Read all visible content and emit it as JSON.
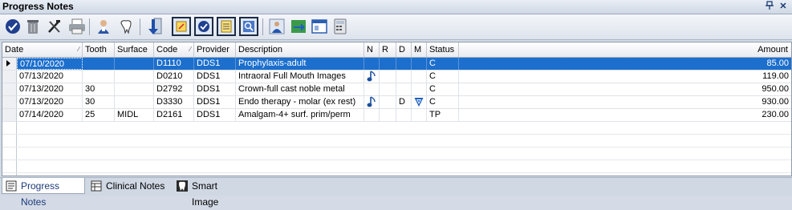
{
  "panel": {
    "title": "Progress Notes",
    "pin_glyph": "ᵖ",
    "close_glyph": "✕"
  },
  "toolbar": {
    "buttons": [
      {
        "icon": "approve-check-icon"
      },
      {
        "icon": "trash-can-icon"
      },
      {
        "icon": "tools-icon"
      },
      {
        "icon": "printer-icon"
      },
      {
        "icon": "patient-icon"
      },
      {
        "icon": "tooth-icon"
      },
      {
        "icon": "download-arrow-icon"
      },
      {
        "icon": "note-pad-icon"
      },
      {
        "icon": "check-note-icon"
      },
      {
        "icon": "list-note-icon"
      },
      {
        "icon": "search-note-icon"
      },
      {
        "icon": "provider-icon"
      },
      {
        "icon": "transfer-icon"
      },
      {
        "icon": "window-icon"
      },
      {
        "icon": "calculator-icon"
      }
    ]
  },
  "grid": {
    "columns": [
      {
        "key": "date",
        "label": "Date",
        "sorted": true
      },
      {
        "key": "tooth",
        "label": "Tooth"
      },
      {
        "key": "surface",
        "label": "Surface"
      },
      {
        "key": "code",
        "label": "Code",
        "sorted": true
      },
      {
        "key": "provider",
        "label": "Provider"
      },
      {
        "key": "description",
        "label": "Description"
      },
      {
        "key": "n",
        "label": "N"
      },
      {
        "key": "r",
        "label": "R"
      },
      {
        "key": "d",
        "label": "D"
      },
      {
        "key": "m",
        "label": "M"
      },
      {
        "key": "status",
        "label": "Status"
      },
      {
        "key": "amount",
        "label": "Amount"
      }
    ],
    "rows": [
      {
        "date": "07/10/2020",
        "tooth": "",
        "surface": "",
        "code": "D1110",
        "provider": "DDS1",
        "description": "Prophylaxis-adult",
        "n": "",
        "r": "",
        "d": "",
        "m": "",
        "status": "C",
        "amount": "85.00",
        "selected": true
      },
      {
        "date": "07/13/2020",
        "tooth": "",
        "surface": "",
        "code": "D0210",
        "provider": "DDS1",
        "description": "Intraoral Full Mouth Images",
        "n": "note",
        "r": "",
        "d": "",
        "m": "",
        "status": "C",
        "amount": "119.00"
      },
      {
        "date": "07/13/2020",
        "tooth": "30",
        "surface": "",
        "code": "D2792",
        "provider": "DDS1",
        "description": "Crown-full cast noble metal",
        "n": "",
        "r": "",
        "d": "",
        "m": "",
        "status": "C",
        "amount": "950.00"
      },
      {
        "date": "07/13/2020",
        "tooth": "30",
        "surface": "",
        "code": "D3330",
        "provider": "DDS1",
        "description": "Endo therapy - molar (ex rest)",
        "n": "note",
        "r": "",
        "d": "D",
        "m": "marker",
        "status": "C",
        "amount": "930.00"
      },
      {
        "date": "07/14/2020",
        "tooth": "25",
        "surface": "MIDL",
        "code": "D2161",
        "provider": "DDS1",
        "description": "Amalgam-4+ surf. prim/perm",
        "n": "",
        "r": "",
        "d": "",
        "m": "",
        "status": "TP",
        "amount": "230.00"
      }
    ]
  },
  "tabs": [
    {
      "label": "Progress Notes",
      "icon": "progress-notes-icon",
      "active": true
    },
    {
      "label": "Clinical Notes",
      "icon": "clinical-notes-icon",
      "active": false
    },
    {
      "label": "Smart Image",
      "icon": "tooth-image-icon",
      "active": false
    }
  ],
  "colors": {
    "selection": "#1c6fcd",
    "note_icon": "#1c4f9c",
    "marker_icon": "#1c5fc0"
  }
}
